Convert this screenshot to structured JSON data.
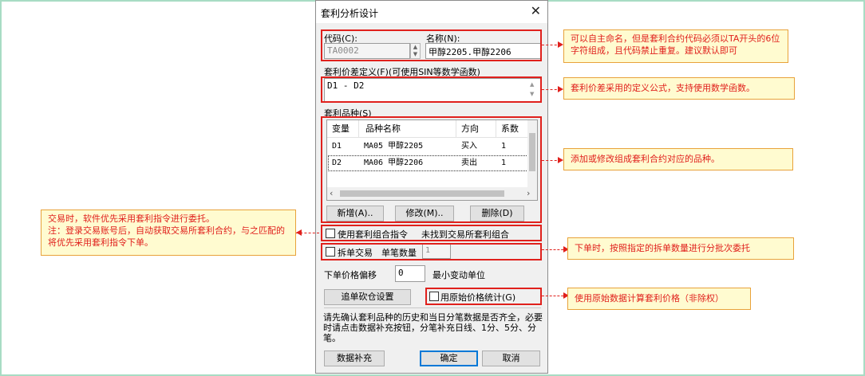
{
  "dialog": {
    "title": "套利分析设计",
    "code_label": "代码(C):",
    "code_value": "TA0002",
    "name_label": "名称(N):",
    "name_value": "甲醇2205.甲醇2206",
    "spread_label": "套利价差定义(F)(可使用SIN等数学函数)",
    "spread_value": "D1 - D2",
    "varieties_label": "套利品种(S)",
    "table": {
      "headers": [
        "变量",
        "品种名称",
        "方向",
        "系数"
      ],
      "rows": [
        [
          "D1",
          "MA05 甲醇2205",
          "买入",
          "1"
        ],
        [
          "D2",
          "MA06 甲醇2206",
          "卖出",
          "1"
        ]
      ]
    },
    "add_button": "新增(A)..",
    "modify_button": "修改(M)..",
    "delete_button": "删除(D)",
    "use_combo_label": "使用套利组合指令",
    "combo_status": "未找到交易所套利组合",
    "split_trade_label": "拆单交易",
    "split_qty_label": "单笔数量",
    "split_qty_value": "1",
    "price_offset_label": "下单价格偏移",
    "price_offset_value": "0",
    "min_unit_label": "最小变动单位",
    "chase_button": "追单砍仓设置",
    "raw_price_label": "用原始价格统计(G)",
    "note": "请先确认套利品种的历史和当日分笔数据是否齐全，必要时请点击数据补充按钮，分笔补充日线、1分、5分、分笔。",
    "data_fill_button": "数据补充",
    "ok_button": "确定",
    "cancel_button": "取消"
  },
  "callouts": {
    "code": "可以自主命名，但是套利合约代码必须以TA开头的6位字符组成，且代码禁止重复。建议默认即可",
    "spread": "套利价差采用的定义公式，支持使用数学函数。",
    "varieties": "添加或修改组成套利合约对应的品种。",
    "combo": "交易时，软件优先采用套利指令进行委托。\n注：登录交易账号后，自动获取交易所套利合约，与之匹配的将优先采用套利指令下单。",
    "split": "下单时，按照指定的拆单数量进行分批次委托",
    "raw_price": "使用原始数据计算套利价格（非除权）"
  },
  "colors": {
    "highlight_border": "#e0201c",
    "callout_fill": "#fffbd0",
    "callout_border": "#e8a23a",
    "frame": "#a8dcc4"
  }
}
